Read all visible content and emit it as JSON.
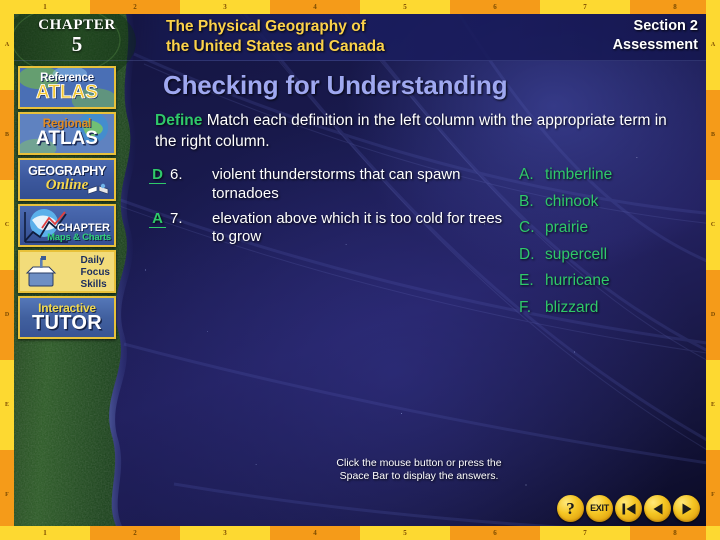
{
  "frame": {
    "top_ruler": [
      "1",
      "2",
      "3",
      "4",
      "5",
      "6",
      "7",
      "8"
    ],
    "bottom_ruler": [
      "1",
      "2",
      "3",
      "4",
      "5",
      "6",
      "7",
      "8"
    ],
    "left_ruler": [
      "A",
      "B",
      "C",
      "D",
      "E",
      "F"
    ],
    "right_ruler": [
      "A",
      "B",
      "C",
      "D",
      "E",
      "F"
    ],
    "accent_yellow": "#fdd931",
    "accent_orange": "#f59b19"
  },
  "header": {
    "chapter_word": "CHAPTER",
    "chapter_number": "5",
    "book_title_line1": "The Physical Geography of",
    "book_title_line2": "the United States and Canada",
    "section_line1": "Section 2",
    "section_line2": "Assessment",
    "title_color": "#fcd24a",
    "section_color": "#ffffff"
  },
  "sidebar": {
    "items": [
      {
        "name": "reference-atlas",
        "line1": "Reference",
        "line2": "ATLAS",
        "icon": "globe-icon"
      },
      {
        "name": "regional-atlas",
        "line1": "Regional",
        "line2": "ATLAS",
        "icon": "globe-icon"
      },
      {
        "name": "geography-online",
        "line1": "GEOGRAPHY",
        "line2": "Online",
        "icon": "open-book-icon"
      },
      {
        "name": "chapter-maps-charts",
        "line1": "CHAPTER",
        "line2": "Maps & Charts",
        "icon": "chart-globe-icon"
      },
      {
        "name": "daily-focus-skills",
        "line1": "Daily",
        "line2": "Focus",
        "line3": "Skills",
        "icon": "projector-icon"
      },
      {
        "name": "interactive-tutor",
        "line1": "Interactive",
        "line2": "TUTOR",
        "icon": "tutor-icon"
      }
    ]
  },
  "main": {
    "title": "Checking for Understanding",
    "title_color": "#9fa8f0",
    "define_label": "Define",
    "define_color": "#2fc96a",
    "define_text": "Match each definition in the left column with the appropriate term in the right column.",
    "questions": [
      {
        "answer": "D",
        "number": "6.",
        "text": "violent thunderstorms that can spawn tornadoes"
      },
      {
        "answer": "A",
        "number": "7.",
        "text": "elevation above which it is too cold for trees to grow"
      }
    ],
    "terms": [
      {
        "letter": "A.",
        "term": "timberline"
      },
      {
        "letter": "B.",
        "term": "chinook"
      },
      {
        "letter": "C.",
        "term": "prairie"
      },
      {
        "letter": "D.",
        "term": "supercell"
      },
      {
        "letter": "E.",
        "term": "hurricane"
      },
      {
        "letter": "F.",
        "term": "blizzard"
      }
    ],
    "term_color": "#2fc96a"
  },
  "footer": {
    "hint_line1": "Click the mouse button or press the",
    "hint_line2": "Space Bar to display the answers.",
    "nav_buttons": [
      {
        "name": "help-button",
        "icon": "question-mark-icon",
        "label": "?"
      },
      {
        "name": "exit-button",
        "icon": "exit-icon",
        "label": "EXIT"
      },
      {
        "name": "first-slide-button",
        "icon": "skip-to-start-icon",
        "label": ""
      },
      {
        "name": "previous-slide-button",
        "icon": "triangle-left-icon",
        "label": ""
      },
      {
        "name": "next-slide-button",
        "icon": "triangle-right-icon",
        "label": ""
      }
    ]
  }
}
